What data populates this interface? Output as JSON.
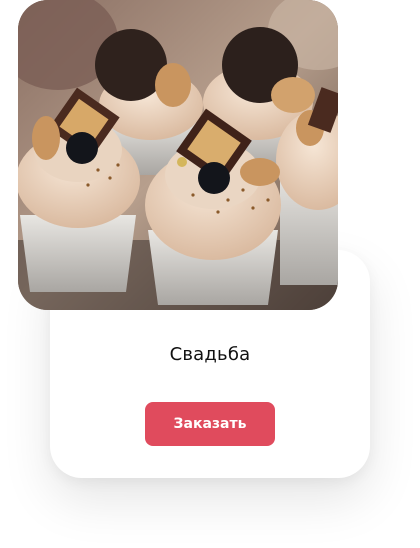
{
  "product_card": {
    "title": "Свадьба",
    "order_button_label": "Заказать",
    "photo_subject": "chocolate cupcakes with cream topping"
  },
  "colors": {
    "accent": "#e04b5d",
    "card_background": "#ffffff",
    "title_text": "#111111"
  }
}
